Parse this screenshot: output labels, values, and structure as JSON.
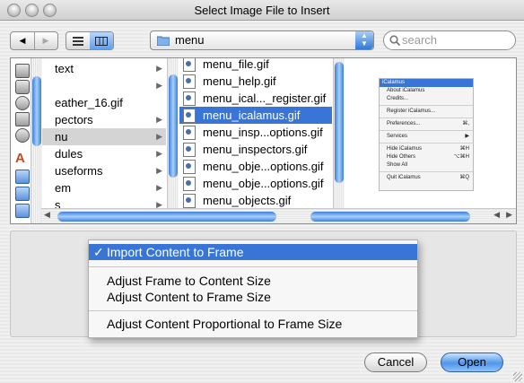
{
  "window": {
    "title": "Select Image File to Insert"
  },
  "toolbar": {
    "path_popup": "menu",
    "search_placeholder": "search"
  },
  "browser": {
    "column1": [
      {
        "label": "text",
        "has_children": true
      },
      {
        "label": "",
        "has_children": true
      },
      {
        "label": "eather_16.gif",
        "has_children": false
      },
      {
        "label": "pectors",
        "has_children": true
      },
      {
        "label": "nu",
        "has_children": true,
        "selected_gray": true
      },
      {
        "label": "dules",
        "has_children": true
      },
      {
        "label": "useforms",
        "has_children": true
      },
      {
        "label": "em",
        "has_children": true
      },
      {
        "label": "s",
        "has_children": true
      }
    ],
    "column2": [
      {
        "label": "menu_file.gif"
      },
      {
        "label": "menu_help.gif"
      },
      {
        "label": "menu_ical..._register.gif"
      },
      {
        "label": "menu_icalamus.gif",
        "selected": true
      },
      {
        "label": "menu_insp...options.gif"
      },
      {
        "label": "menu_inspectors.gif"
      },
      {
        "label": "menu_obje...options.gif"
      },
      {
        "label": "menu_obje...options.gif"
      },
      {
        "label": "menu_objects.gif"
      }
    ],
    "preview": {
      "header": "iCalamus",
      "items": [
        {
          "label": "About iCalamus"
        },
        {
          "label": "Credits..."
        },
        {
          "sep": true
        },
        {
          "label": "Register iCalamus..."
        },
        {
          "sep": true
        },
        {
          "label": "Preferences...",
          "shortcut": "⌘,"
        },
        {
          "sep": true
        },
        {
          "label": "Services",
          "shortcut": "▶"
        },
        {
          "sep": true
        },
        {
          "label": "Hide iCalamus",
          "shortcut": "⌘H"
        },
        {
          "label": "Hide Others",
          "shortcut": "⌥⌘H"
        },
        {
          "label": "Show All"
        },
        {
          "sep": true
        },
        {
          "label": "Quit iCalamus",
          "shortcut": "⌘Q"
        }
      ]
    }
  },
  "popup_menu": {
    "checkmark": "✓",
    "items": {
      "import": "Import Content to Frame",
      "adjust_frame": "Adjust Frame to Content Size",
      "adjust_content": "Adjust Content to Frame Size",
      "adjust_proportional": "Adjust Content Proportional to Frame Size"
    }
  },
  "buttons": {
    "cancel": "Cancel",
    "open": "Open"
  },
  "colors": {
    "selection": "#3875d7",
    "primary_button": "#4f95ea"
  }
}
